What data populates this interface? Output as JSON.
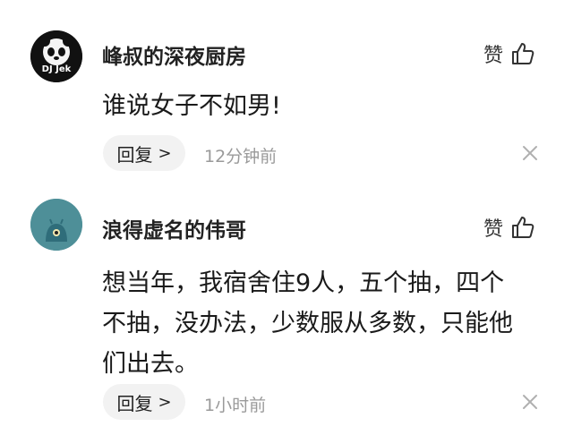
{
  "comments": [
    {
      "username": "峰叔的深夜厨房",
      "avatar_text": "DJ Jek",
      "like_label": "赞",
      "lines": [
        "谁说女子不如男!"
      ],
      "reply_label": "回复",
      "reply_chevron": ">",
      "time": "12分钟前"
    },
    {
      "username": "浪得虚名的伟哥",
      "like_label": "赞",
      "lines": [
        "想当年，我宿舍住9人，五个抽，四个",
        "不抽，没办法，少数服从多数，只能他",
        "们出去。"
      ],
      "reply_label": "回复",
      "reply_chevron": ">",
      "time": "1小时前"
    }
  ],
  "colors": {
    "avatar2_bg": "#4e8f98",
    "reply_bg": "#f2f2f2",
    "time_text": "#9a9a9a"
  }
}
